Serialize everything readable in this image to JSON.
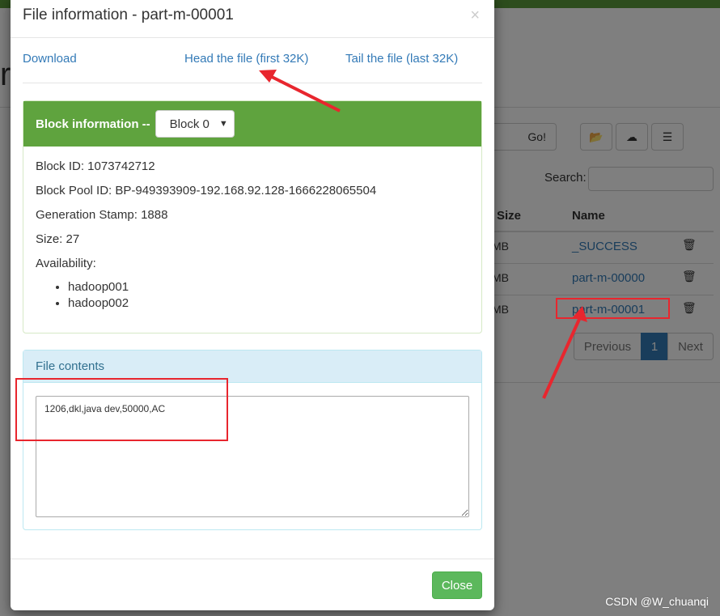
{
  "background": {
    "go_label": "Go!",
    "search_label": "Search:",
    "columns": [
      "Size",
      "Name"
    ],
    "rows": [
      {
        "size": "MB",
        "name": "_SUCCESS"
      },
      {
        "size": "MB",
        "name": "part-m-00000"
      },
      {
        "size": "MB",
        "name": "part-m-00001"
      }
    ],
    "pagination": {
      "previous": "Previous",
      "current": "1",
      "next": "Next"
    },
    "heading_fragment": "r"
  },
  "modal": {
    "title": "File information - part-m-00001",
    "close_glyph": "×",
    "links": {
      "download": "Download",
      "head": "Head the file (first 32K)",
      "tail": "Tail the file (last 32K)"
    },
    "block_panel": {
      "heading": "Block information --",
      "selected_block": "Block 0",
      "block_id": "Block ID: 1073742712",
      "block_pool_id": "Block Pool ID: BP-949393909-192.168.92.128-1666228065504",
      "generation_stamp": "Generation Stamp: 1888",
      "size": "Size: 27",
      "availability_label": "Availability:",
      "nodes": [
        "hadoop001",
        "hadoop002"
      ]
    },
    "contents_panel": {
      "heading": "File contents",
      "text": "1206,dkl,java dev,50000,AC"
    },
    "close_label": "Close"
  },
  "watermark": "CSDN @W_chuanqi",
  "colors": {
    "success": "#5fa33e",
    "info_bg": "#d9edf7",
    "link": "#337ab7",
    "annotation": "#e8262e"
  }
}
